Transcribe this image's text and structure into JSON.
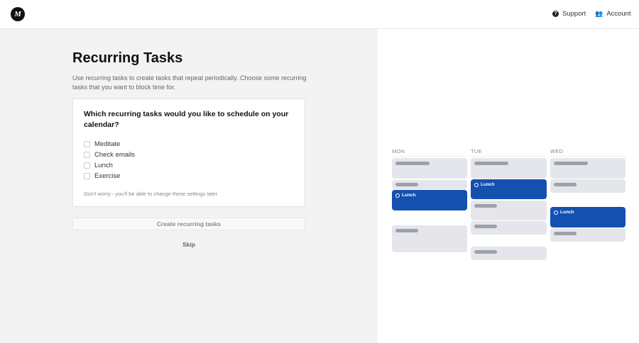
{
  "header": {
    "logo": "M",
    "support": "Support",
    "account": "Account"
  },
  "main": {
    "title": "Recurring Tasks",
    "description": "Use recurring tasks to create tasks that repeat periodically. Choose some recurring tasks that you want to block time for.",
    "question": "Which recurring tasks would you like to schedule on your calendar?",
    "options": [
      {
        "label": "Meditate",
        "checked": false
      },
      {
        "label": "Check emails",
        "checked": false
      },
      {
        "label": "Lunch",
        "checked": false
      },
      {
        "label": "Exercise",
        "checked": false
      }
    ],
    "note": "Don't worry - you'll be able to change these settings later",
    "create_label": "Create recurring tasks",
    "skip_label": "Skip"
  },
  "calendar": {
    "days": [
      "MON",
      "TUE",
      "WED"
    ],
    "event_label": "Lunch",
    "colors": {
      "event": "#1450b0",
      "placeholder": "#e4e6eb"
    }
  }
}
